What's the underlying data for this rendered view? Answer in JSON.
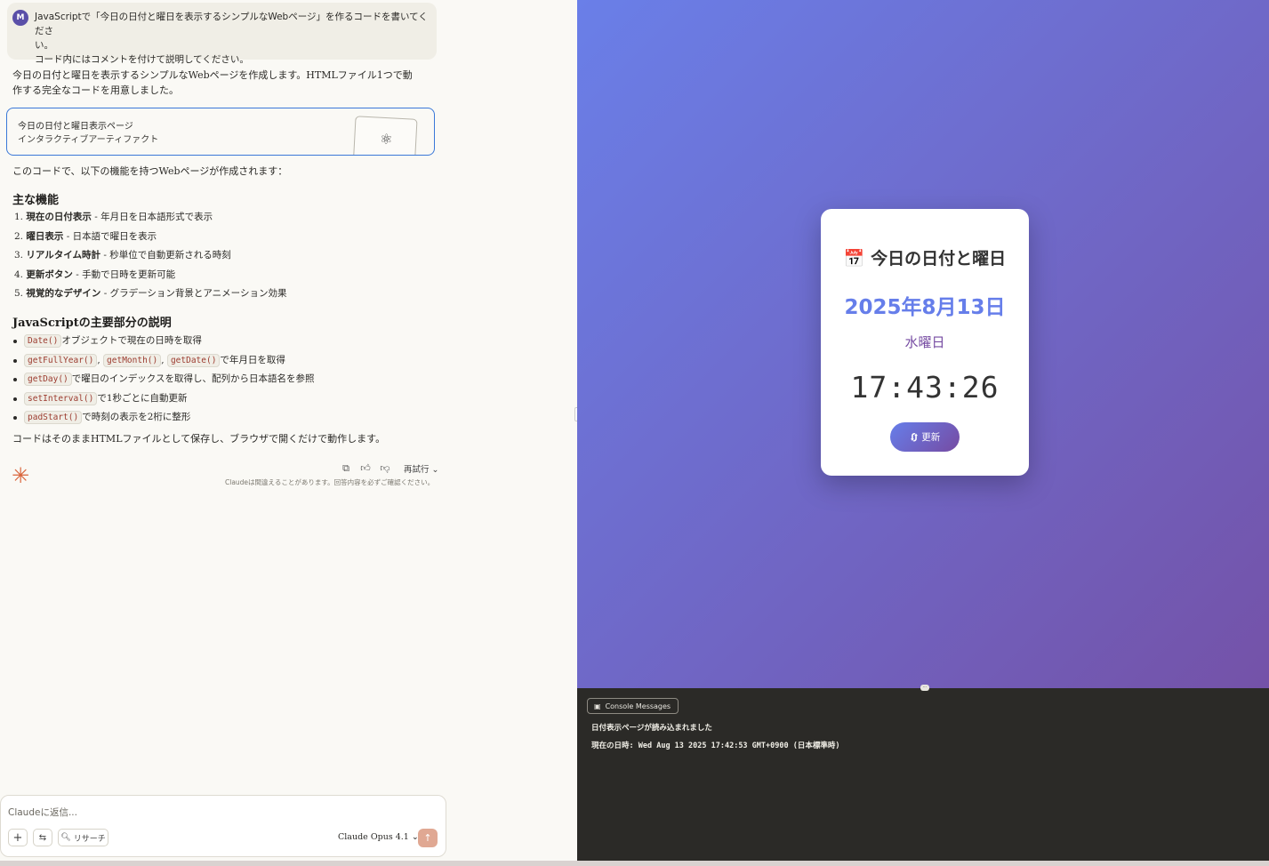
{
  "chat": {
    "user": {
      "avatar": "M",
      "line1": "JavaScriptで「今日の日付と曜日を表示するシンプルなWebページ」を作るコードを書いてくださ",
      "line2": "い。",
      "line3": "コード内にはコメントを付けて説明してください。"
    },
    "intro": "今日の日付と曜日を表示するシンプルなWebページを作成します。HTMLファイル1つで動作する完全なコードを用意しました。",
    "artifact": {
      "title": "今日の日付と曜日表示ページ",
      "subtitle": "インタラクティブアーティファクト",
      "icon": "atom-icon"
    },
    "features_intro": "このコードで、以下の機能を持つWebページが作成されます：",
    "features_heading": "主な機能",
    "features": [
      {
        "num": "1.",
        "bold": "現在の日付表示",
        "text": " - 年月日を日本語形式で表示"
      },
      {
        "num": "2.",
        "bold": "曜日表示",
        "text": " - 日本語で曜日を表示"
      },
      {
        "num": "3.",
        "bold": "リアルタイム時計",
        "text": " - 秒単位で自動更新される時刻"
      },
      {
        "num": "4.",
        "bold": "更新ボタン",
        "text": " - 手動で日時を更新可能"
      },
      {
        "num": "5.",
        "bold": "視覚的なデザイン",
        "text": " - グラデーション背景とアニメーション効果"
      }
    ],
    "js_heading": "JavaScriptの主要部分の説明",
    "js_items": [
      {
        "codes": [
          "Date()"
        ],
        "text": "オブジェクトで現在の日時を取得"
      },
      {
        "codes": [
          "getFullYear()",
          "getMonth()",
          "getDate()"
        ],
        "text": "で年月日を取得"
      },
      {
        "codes": [
          "getDay()"
        ],
        "text": "で曜日のインデックスを取得し、配列から日本語名を参照"
      },
      {
        "codes": [
          "setInterval()"
        ],
        "text": "で1秒ごとに自動更新"
      },
      {
        "codes": [
          "padStart()"
        ],
        "text": "で時刻の表示を2桁に整形"
      }
    ],
    "closing": "コードはそのままHTMLファイルとして保存し、ブラウザで開くだけで動作します。",
    "actions": {
      "retry": "再試行",
      "disclaimer": "Claudeは間違えることがあります。回答内容を必ずご確認ください。"
    },
    "composer": {
      "placeholder": "Claudeに返信...",
      "research": "リサーチ",
      "model_brand": "Claude",
      "model_name": "Opus 4.1"
    }
  },
  "preview": {
    "title_icon": "📅",
    "title": "今日の日付と曜日",
    "date": "2025年8月13日",
    "day": "水曜日",
    "time": "17:43:26",
    "refresh_label": "更新",
    "colors": {
      "gradient_start": "#667eea",
      "gradient_end": "#764ba2"
    }
  },
  "console": {
    "tab": "Console Messages",
    "lines": [
      "日付表示ページが読み込まれました",
      "現在の日時: Wed Aug 13 2025 17:42:53 GMT+0900 (日本標準時)"
    ]
  }
}
